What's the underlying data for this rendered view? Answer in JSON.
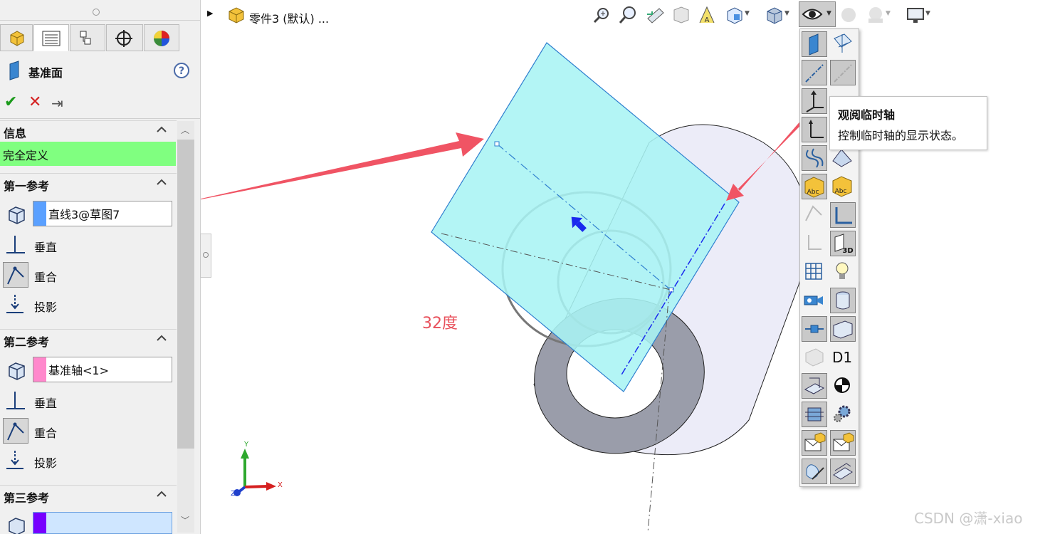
{
  "feature_tree": {
    "title": "零件3 (默认) ..."
  },
  "property_manager": {
    "title": "基准面",
    "actions": {
      "ok": "✔",
      "cancel": "✕",
      "pin": "⇥"
    },
    "info_section": {
      "header": "信息",
      "status": "完全定义",
      "status_color": "#80ff80"
    },
    "first_ref": {
      "header": "第一参考",
      "value": "直线3@草图7",
      "color": "#5aa0ff",
      "options": [
        "垂直",
        "重合",
        "投影"
      ]
    },
    "second_ref": {
      "header": "第二参考",
      "value": "基准轴<1>",
      "color": "#ff88cc",
      "options": [
        "垂直",
        "重合",
        "投影"
      ]
    },
    "third_ref": {
      "header": "第三参考",
      "value": "",
      "color": "#7700ff"
    }
  },
  "viewport": {
    "annotation": "32度",
    "annotation_color": "#e8505b",
    "triad": {
      "x": "X",
      "y": "Y",
      "z": "Z"
    },
    "icon_text": {
      "d1": "D1",
      "abc": "Abc",
      "three_d": "3D"
    },
    "watermark": "CSDN @潇-xiao"
  },
  "tooltip": {
    "title": "观阅临时轴",
    "body": "控制临时轴的显示状态。"
  },
  "colors": {
    "plane_fill": "#a8f4f4",
    "plane_edge": "#2f7fcf",
    "arrow": "#f05464",
    "tube_side": "#ececf8",
    "tube_face": "#9a9daa"
  }
}
